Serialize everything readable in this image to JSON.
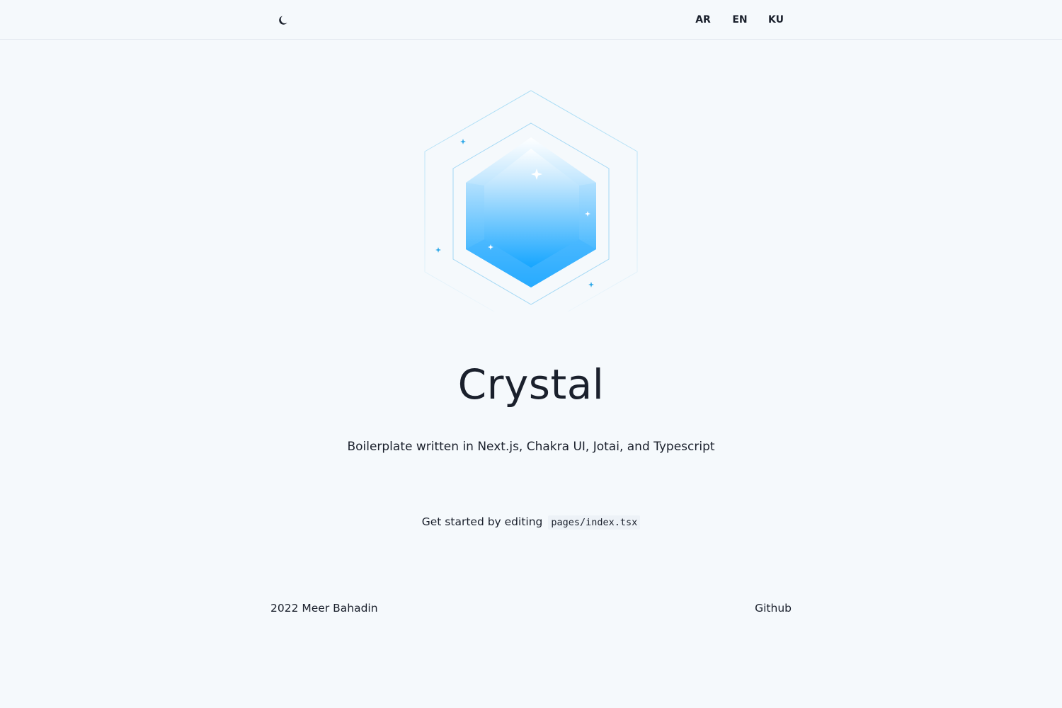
{
  "header": {
    "theme_toggle_icon": "moon-icon",
    "languages": [
      "AR",
      "EN",
      "KU"
    ]
  },
  "hero": {
    "logo_icon": "crystal-gem-icon",
    "title": "Crystal",
    "subtitle": "Boilerplate written in Next.js, Chakra UI, Jotai, and Typescript",
    "get_started_text": "Get started by editing",
    "get_started_code": "pages/index.tsx"
  },
  "footer": {
    "copyright": "2022 Meer Bahadin",
    "github_link": "Github"
  },
  "colors": {
    "background": "#f5f9fc",
    "text": "#1a202c",
    "crystal_light": "#e8f6ff",
    "crystal_dark": "#12a4ff",
    "code_bg": "#edf2f7"
  }
}
